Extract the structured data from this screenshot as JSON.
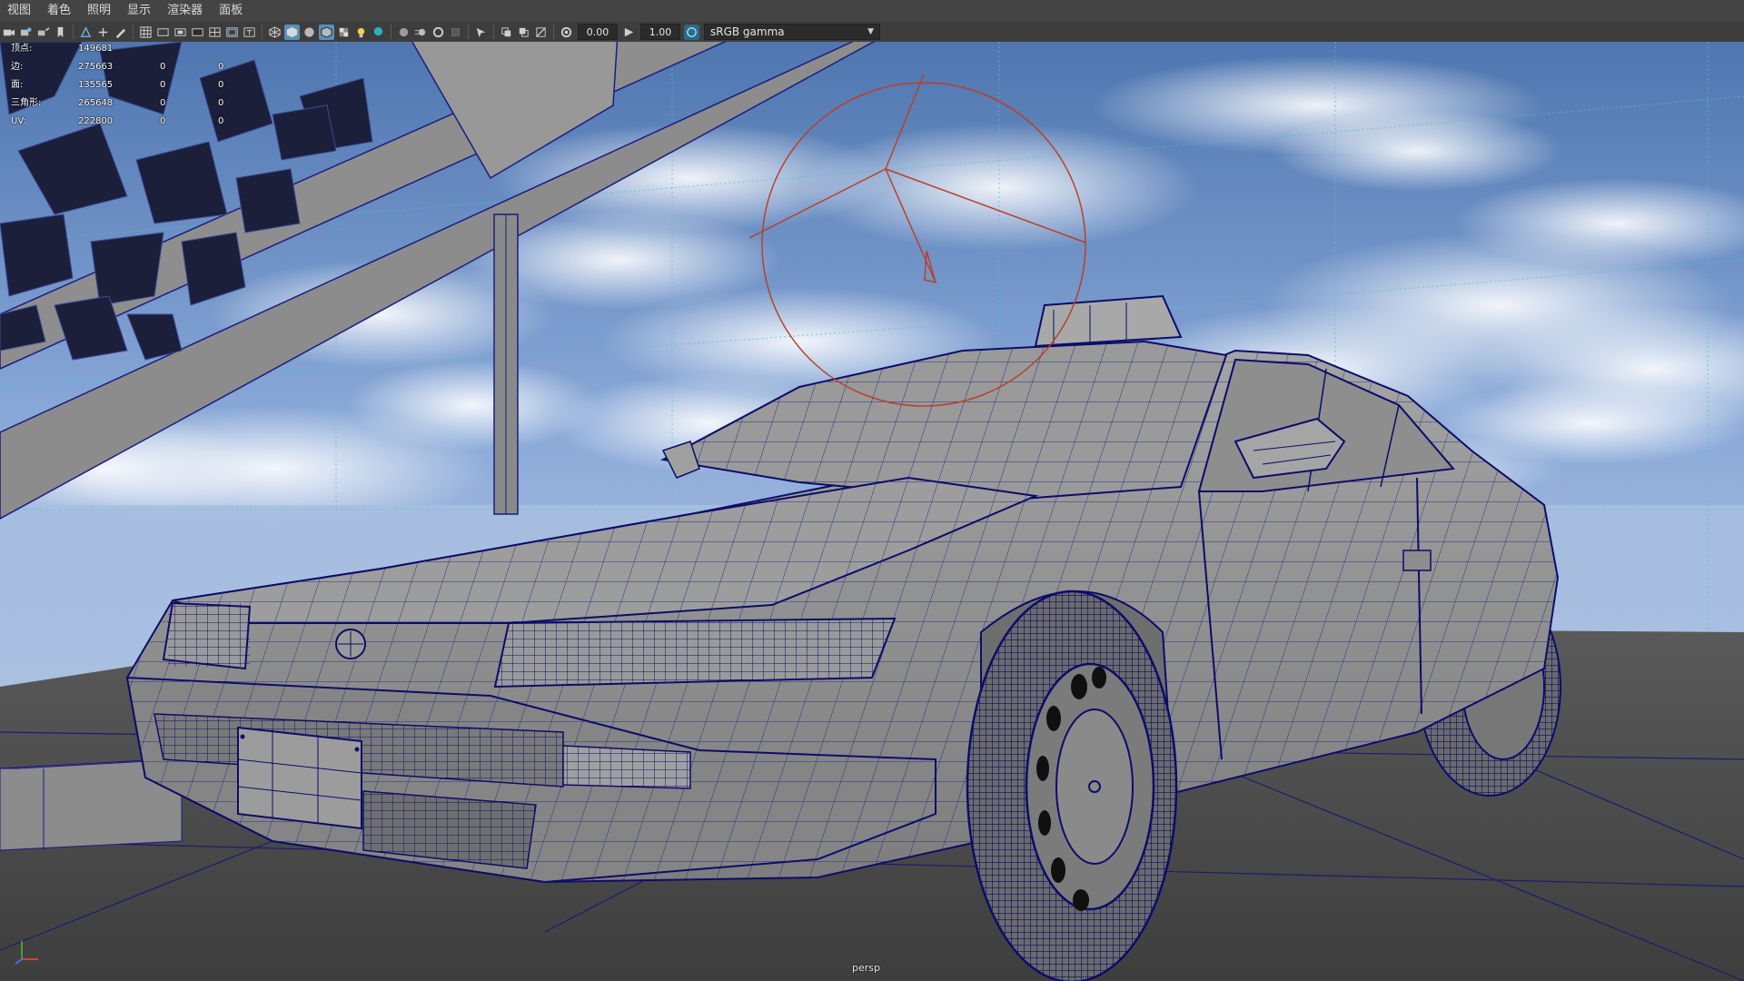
{
  "menu": {
    "items": [
      "视图",
      "着色",
      "照明",
      "显示",
      "渲染器",
      "面板"
    ]
  },
  "toolbar": {
    "field_exposure": "0.00",
    "field_gamma": "1.00",
    "color_space": "sRGB gamma"
  },
  "hud": {
    "rows": [
      {
        "label": "顶点:",
        "v1": "149681",
        "v2": "",
        "v3": ""
      },
      {
        "label": "边:",
        "v1": "275663",
        "v2": "0",
        "v3": "0"
      },
      {
        "label": "面:",
        "v1": "135565",
        "v2": "0",
        "v3": "0"
      },
      {
        "label": "三角形:",
        "v1": "265648",
        "v2": "0",
        "v3": "0"
      },
      {
        "label": "UV:",
        "v1": "222800",
        "v2": "0",
        "v3": "0"
      }
    ]
  },
  "viewport": {
    "camera": "persp"
  },
  "colors": {
    "sky_top": "#5b7fb6",
    "sky_bottom": "#9fb9df",
    "ground": "#4a4a4a",
    "model_gray": "#8f8f8f",
    "wire": "#1a1a7a",
    "manipulator": "#b8402a",
    "grid_line": "#48c8c0"
  },
  "icons": [
    "camera-icon",
    "select-camera-icon",
    "bookmark-icon",
    "grid-icon",
    "wireframe-icon",
    "smooth-shade-icon",
    "xray-icon",
    "light-icon",
    "exposure-icon",
    "gamma-icon",
    "colorspace-icon"
  ]
}
